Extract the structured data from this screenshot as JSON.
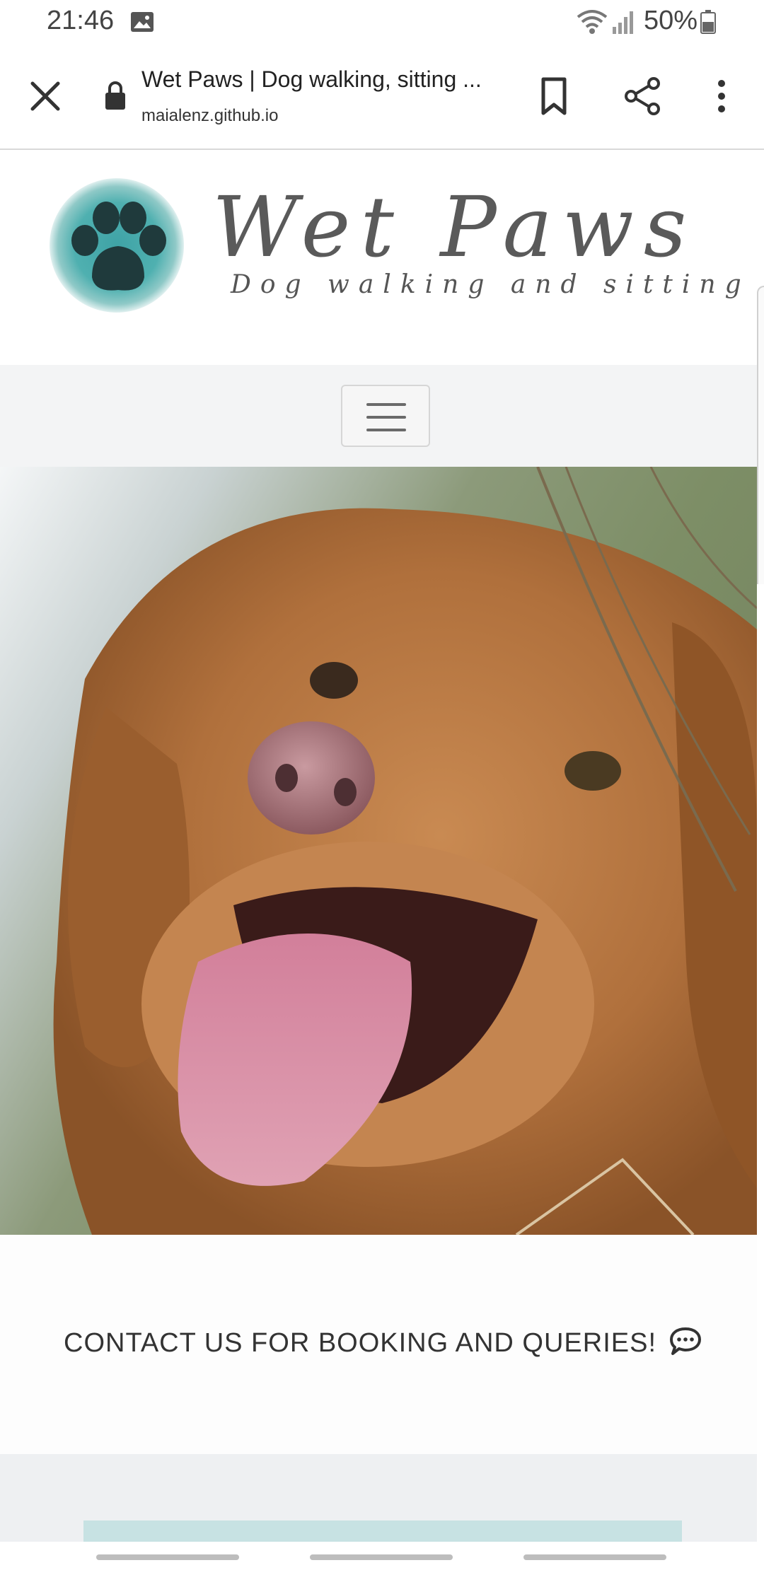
{
  "status_bar": {
    "time": "21:46",
    "battery_percent": "50%",
    "icons": [
      "gallery-icon",
      "wifi-icon",
      "signal-icon",
      "battery-icon"
    ]
  },
  "browser": {
    "page_title": "Wet Paws | Dog walking, sitting ...",
    "url": "maialenz.github.io",
    "icons": [
      "close-icon",
      "lock-icon",
      "bookmark-icon",
      "share-icon",
      "more-vert-icon"
    ]
  },
  "site": {
    "brand_name": "Wet Paws",
    "tagline": "Dog walking and sitting",
    "logo_icon": "paw-icon",
    "nav_toggle_icon": "hamburger-icon",
    "hero_image": "dog-photo",
    "contact_text": "CONTACT US FOR BOOKING AND QUERIES!",
    "contact_icon": "chat-bubble-icon"
  },
  "colors": {
    "brand_teal": "#4fb0b0",
    "text_gray": "#5a5a5a",
    "nav_bg": "#f3f4f5",
    "footer_strip": "#c7e2e3"
  }
}
